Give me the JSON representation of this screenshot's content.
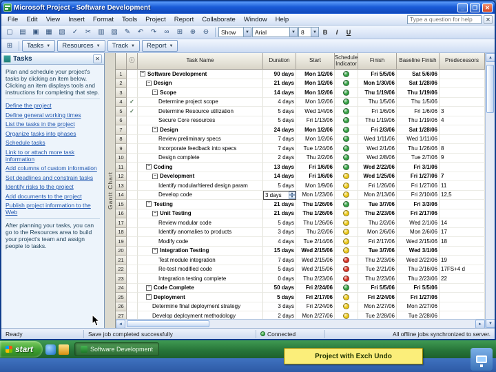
{
  "window": {
    "title": "Microsoft Project - Software Development"
  },
  "menu": {
    "items": [
      "File",
      "Edit",
      "View",
      "Insert",
      "Format",
      "Tools",
      "Project",
      "Report",
      "Collaborate",
      "Window",
      "Help"
    ],
    "help_placeholder": "Type a question for help"
  },
  "toolbar": {
    "icons": [
      {
        "name": "new-document-icon",
        "glyph": "▢"
      },
      {
        "name": "open-folder-icon",
        "glyph": "▤"
      },
      {
        "name": "save-icon",
        "glyph": "▣"
      },
      {
        "name": "print-icon",
        "glyph": "▦"
      },
      {
        "name": "print-preview-icon",
        "glyph": "▧"
      },
      {
        "name": "spelling-icon",
        "glyph": "✓"
      },
      {
        "name": "cut-icon",
        "glyph": "✂"
      },
      {
        "name": "copy-icon",
        "glyph": "▥"
      },
      {
        "name": "paste-icon",
        "glyph": "▨"
      },
      {
        "name": "format-painter-icon",
        "glyph": "✎"
      },
      {
        "name": "undo-icon",
        "glyph": "↶"
      },
      {
        "name": "redo-icon",
        "glyph": "↷"
      },
      {
        "name": "hyperlink-icon",
        "glyph": "∞"
      },
      {
        "name": "link-tasks-icon",
        "glyph": "⊞"
      },
      {
        "name": "zoom-in-icon",
        "glyph": "⊕"
      },
      {
        "name": "zoom-out-icon",
        "glyph": "⊖"
      }
    ],
    "show_label": "Show",
    "font_name": "Arial",
    "font_size": "8",
    "format_buttons": [
      "B",
      "I",
      "U"
    ]
  },
  "guide_toolbar": {
    "buttons": [
      "Tasks",
      "Resources",
      "Track",
      "Report"
    ]
  },
  "task_pane": {
    "title": "Tasks",
    "intro": "Plan and schedule your project's tasks by clicking an item below. Clicking an item displays tools and instructions for completing that step.",
    "links": [
      "Define the project",
      "Define general working times",
      "List the tasks in the project",
      "Organize tasks into phases",
      "Schedule tasks",
      "Link to or attach more task information",
      "Add columns of custom information",
      "Set deadlines and constrain tasks",
      "Identify risks to the project",
      "Add documents to the project",
      "Publish project information to the Web"
    ],
    "footer": "After planning your tasks, you can go to the Resources area to build your project's team and assign people to tasks."
  },
  "view_label": "Gantt Chart",
  "table": {
    "columns": [
      "",
      "ⓘ",
      "Task Name",
      "Duration",
      "Start",
      "Schedule Indicator",
      "Finish",
      "Baseline Finish",
      "Predecessors"
    ],
    "rows": [
      {
        "n": 1,
        "name": "Software Development",
        "lvl": 0,
        "sum": true,
        "dur": "90 days",
        "start": "Mon 1/2/06",
        "ind": "green",
        "fin": "Fri 5/5/06",
        "base": "Sat 5/6/06",
        "pred": ""
      },
      {
        "n": 2,
        "name": "Design",
        "lvl": 1,
        "sum": true,
        "dur": "21 days",
        "start": "Mon 1/2/06",
        "ind": "green",
        "fin": "Mon 1/30/06",
        "base": "Sat 1/28/06",
        "pred": ""
      },
      {
        "n": 3,
        "name": "Scope",
        "lvl": 2,
        "sum": true,
        "dur": "14 days",
        "start": "Mon 1/2/06",
        "ind": "green",
        "fin": "Thu 1/19/06",
        "base": "Thu 1/19/06",
        "pred": ""
      },
      {
        "n": 4,
        "name": "Determine project scope",
        "lvl": 3,
        "check": true,
        "dur": "4 days",
        "start": "Mon 1/2/06",
        "ind": "green",
        "fin": "Thu 1/5/06",
        "base": "Thu 1/5/06",
        "pred": ""
      },
      {
        "n": 5,
        "name": "Determine Resource utilization",
        "lvl": 3,
        "check": true,
        "dur": "5 days",
        "start": "Wed 1/4/06",
        "ind": "green",
        "fin": "Fri 1/6/06",
        "base": "Fri 1/6/06",
        "pred": "3"
      },
      {
        "n": 6,
        "name": "Secure Core resources",
        "lvl": 3,
        "dur": "5 days",
        "start": "Fri 1/13/06",
        "ind": "green",
        "fin": "Thu 1/19/06",
        "base": "Thu 1/19/06",
        "pred": "4"
      },
      {
        "n": 7,
        "name": "Design",
        "lvl": 2,
        "sum": true,
        "dur": "24 days",
        "start": "Mon 1/2/06",
        "ind": "green",
        "fin": "Fri 2/3/06",
        "base": "Sat 1/28/06",
        "pred": ""
      },
      {
        "n": 8,
        "name": "Review preliminary specs",
        "lvl": 3,
        "dur": "7 days",
        "start": "Mon 1/2/06",
        "ind": "green",
        "fin": "Wed 1/11/06",
        "base": "Wed 1/11/06",
        "pred": ""
      },
      {
        "n": 9,
        "name": "Incorporate feedback into specs",
        "lvl": 3,
        "dur": "7 days",
        "start": "Tue 1/24/06",
        "ind": "green",
        "fin": "Wed 2/1/06",
        "base": "Thu 1/26/06",
        "pred": "8"
      },
      {
        "n": 10,
        "name": "Design complete",
        "lvl": 3,
        "dur": "2 days",
        "start": "Thu 2/2/06",
        "ind": "green",
        "fin": "Wed 2/8/06",
        "base": "Tue 2/7/06",
        "pred": "9"
      },
      {
        "n": 11,
        "name": "Coding",
        "lvl": 1,
        "sum": true,
        "dur": "13 days",
        "start": "Fri 1/6/06",
        "ind": "green",
        "fin": "Wed 2/22/06",
        "base": "Fri 3/1/06",
        "pred": ""
      },
      {
        "n": 12,
        "name": "Development",
        "lvl": 2,
        "sum": true,
        "dur": "14 days",
        "start": "Fri 1/6/06",
        "ind": "yellow",
        "fin": "Wed 1/25/06",
        "base": "Fri 1/27/06",
        "pred": "7"
      },
      {
        "n": 13,
        "name": "Identify modular/tiered design param",
        "lvl": 3,
        "dur": "5 days",
        "start": "Mon 1/9/06",
        "ind": "yellow",
        "fin": "Fri 1/26/06",
        "base": "Fri 1/27/06",
        "pred": "11"
      },
      {
        "n": 14,
        "name": "Develop code",
        "lvl": 3,
        "sel": true,
        "dur": "3 days",
        "start": "Mon 1/23/06",
        "ind": "yellow",
        "fin": "Mon 2/13/06",
        "base": "Fri 2/10/06",
        "pred": "12,5"
      },
      {
        "n": 15,
        "name": "Testing",
        "lvl": 1,
        "sum": true,
        "dur": "21 days",
        "start": "Thu 1/26/06",
        "ind": "green",
        "fin": "Tue 3/7/06",
        "base": "Fri 3/3/06",
        "pred": ""
      },
      {
        "n": 16,
        "name": "Unit Testing",
        "lvl": 2,
        "sum": true,
        "dur": "21 days",
        "start": "Thu 1/26/06",
        "ind": "yellow",
        "fin": "Thu 2/23/06",
        "base": "Fri 2/17/06",
        "pred": ""
      },
      {
        "n": 17,
        "name": "Review modular code",
        "lvl": 3,
        "dur": "5 days",
        "start": "Thu 1/26/06",
        "ind": "yellow",
        "fin": "Thu 2/2/06",
        "base": "Wed 2/1/06",
        "pred": "14"
      },
      {
        "n": 18,
        "name": "Identify anomalies to products",
        "lvl": 3,
        "dur": "3 days",
        "start": "Thu 2/2/06",
        "ind": "yellow",
        "fin": "Mon 2/6/06",
        "base": "Mon 2/6/06",
        "pred": "17"
      },
      {
        "n": 19,
        "name": "Modify code",
        "lvl": 3,
        "dur": "4 days",
        "start": "Tue 2/14/06",
        "ind": "yellow",
        "fin": "Fri 2/17/06",
        "base": "Wed 2/15/06",
        "pred": "18"
      },
      {
        "n": 20,
        "name": "Integration Testing",
        "lvl": 2,
        "sum": true,
        "dur": "15 days",
        "start": "Wed 2/15/06",
        "ind": "yellow",
        "fin": "Tue 3/7/06",
        "base": "Wed 3/1/06",
        "pred": ""
      },
      {
        "n": 21,
        "name": "Test module integration",
        "lvl": 3,
        "dur": "7 days",
        "start": "Wed 2/15/06",
        "ind": "red",
        "fin": "Thu 2/23/06",
        "base": "Wed 2/22/06",
        "pred": "19"
      },
      {
        "n": 22,
        "name": "Re-test modified code",
        "lvl": 3,
        "dur": "5 days",
        "start": "Wed 2/15/06",
        "ind": "red",
        "fin": "Tue 2/21/06",
        "base": "Thu 2/16/06",
        "pred": "17FS+4 d"
      },
      {
        "n": 23,
        "name": "Integration testing complete",
        "lvl": 3,
        "dur": "0 days",
        "start": "Thu 2/23/06",
        "ind": "red",
        "fin": "Thu 2/23/06",
        "base": "Thu 2/23/06",
        "pred": "22"
      },
      {
        "n": 24,
        "name": "Code Complete",
        "lvl": 1,
        "sum": true,
        "dur": "50 days",
        "start": "Fri 2/24/06",
        "ind": "green",
        "fin": "Fri 5/5/06",
        "base": "Fri 5/5/06",
        "pred": ""
      },
      {
        "n": 25,
        "name": "Deployment",
        "lvl": 1,
        "sum": true,
        "dur": "5 days",
        "start": "Fri 2/17/06",
        "ind": "yellow",
        "fin": "Fri 2/24/06",
        "base": "Fri 1/27/06",
        "pred": ""
      },
      {
        "n": 26,
        "name": "Determine final deployment strategy",
        "lvl": 2,
        "dur": "3 days",
        "start": "Fri 2/24/06",
        "ind": "yellow",
        "fin": "Mon 2/27/06",
        "base": "Mon 2/27/06",
        "pred": ""
      },
      {
        "n": 27,
        "name": "Develop deployment methodology",
        "lvl": 2,
        "dur": "2 days",
        "start": "Mon 2/27/06",
        "ind": "yellow",
        "fin": "Tue 2/28/06",
        "base": "Tue 2/28/06",
        "pred": ""
      }
    ]
  },
  "status_bar": {
    "ready": "Ready",
    "message": "Save job completed successfully",
    "connection": "Connected",
    "sync": "All offline jobs synchronized to server."
  },
  "taskbar": {
    "start_label": "start",
    "task_button": "Software Development"
  },
  "annotation": "Project with Exch Undo",
  "colors": {
    "indicator_green": "#35a244",
    "indicator_yellow": "#ecc91a",
    "indicator_red": "#d93425"
  },
  "ui": {
    "minimize": "_",
    "maximize": "❐",
    "close": "✕",
    "dropdown": "▼",
    "guide_icon": "⊞",
    "up": "▲",
    "down": "▼",
    "left": "◄",
    "right": "►",
    "check": "✓",
    "collapse": "−",
    "spin_up": "▲",
    "spin_down": "▼"
  }
}
